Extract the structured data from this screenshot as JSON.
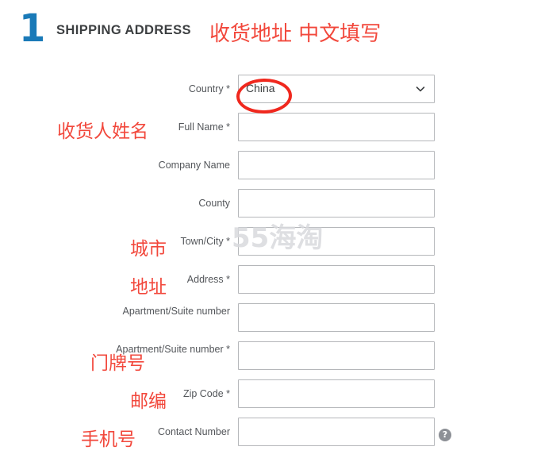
{
  "watermark": "55海淘",
  "header": {
    "step_number": "1",
    "title": "SHIPPING ADDRESS",
    "annotation": "收货地址 中文填写",
    "number_color": "#1a7ab8",
    "title_color": "#3c3f41",
    "annotation_color": "#f2483c"
  },
  "form": {
    "rows": [
      {
        "label": "Country *",
        "type": "select",
        "value": "China",
        "chevron_icon": "chevron-down-icon",
        "annotation": "",
        "circled": true
      },
      {
        "label": "Full Name *",
        "type": "text",
        "value": "",
        "annotation": "收货人姓名"
      },
      {
        "label": "Company Name",
        "type": "text",
        "value": "",
        "annotation": ""
      },
      {
        "label": "County",
        "type": "text",
        "value": "",
        "annotation": ""
      },
      {
        "label": "Town/City *",
        "type": "text",
        "value": "",
        "annotation": "城市"
      },
      {
        "label": "Address *",
        "type": "text",
        "value": "",
        "annotation": "地址"
      },
      {
        "label": "Apartment/Suite number",
        "type": "text",
        "value": "",
        "annotation": ""
      },
      {
        "label": "Apartment/Suite number *",
        "type": "text",
        "value": "",
        "annotation": "门牌号"
      },
      {
        "label": "Zip Code *",
        "type": "text",
        "value": "",
        "annotation": "邮编"
      },
      {
        "label": "Contact Number",
        "type": "text",
        "value": "",
        "annotation": "手机号",
        "help_icon": "help-circle-icon",
        "help_label": "?"
      }
    ]
  },
  "annotations": {
    "full_name": "收货人姓名",
    "town_city": "城市",
    "address": "地址",
    "apartment": "门牌号",
    "zip_code": "邮编",
    "contact_number": "手机号"
  },
  "colors": {
    "accent_blue": "#1a7ab8",
    "annotation_red": "#f2483c",
    "circle_red": "#f0281e",
    "field_border": "#b5b7ba",
    "label_text": "#53565a",
    "watermark": "#d9dade"
  }
}
